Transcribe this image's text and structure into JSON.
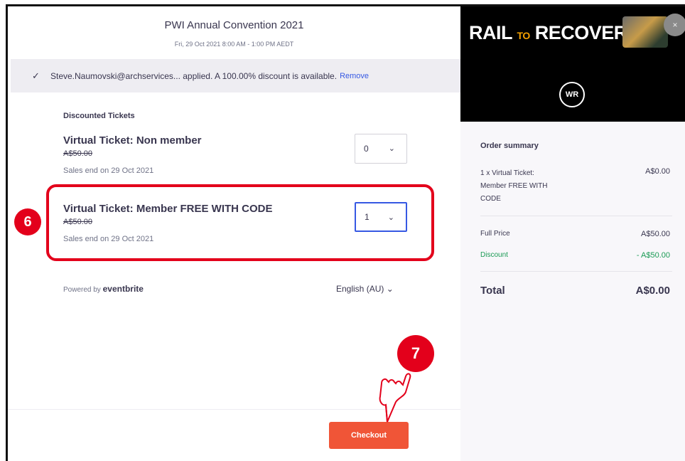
{
  "event": {
    "title": "PWI Annual Convention 2021",
    "datetime": "Fri, 29 Oct 2021 8:00 AM - 1:00 PM AEDT"
  },
  "promo": {
    "message": "Steve.Naumovski@archservices... applied. A 100.00% discount is available.",
    "remove_label": "Remove",
    "icon": "check-icon"
  },
  "tickets": {
    "section_heading": "Discounted Tickets",
    "items": [
      {
        "name": "Virtual Ticket: Non member",
        "price": "A$50.00",
        "sales_end": "Sales end on 29 Oct 2021",
        "quantity": "0"
      },
      {
        "name": "Virtual Ticket: Member FREE WITH CODE",
        "price": "A$50.00",
        "sales_end": "Sales end on 29 Oct 2021",
        "quantity": "1"
      }
    ]
  },
  "footer": {
    "powered_prefix": "Powered by",
    "powered_brand": "eventbrite",
    "language": "English (AU)",
    "checkout_label": "Checkout"
  },
  "annotations": {
    "step6": "6",
    "step7": "7",
    "highlight_color": "#e3001b"
  },
  "hero": {
    "title_rail": "RAIL",
    "title_to": "TO",
    "title_recovery": "RECOVERY",
    "logo_text": "WR",
    "close_label": "×"
  },
  "summary": {
    "title": "Order summary",
    "line_item": "1 x Virtual Ticket: Member FREE WITH CODE",
    "line_amount": "A$0.00",
    "full_price_label": "Full Price",
    "full_price_amount": "A$50.00",
    "discount_label": "Discount",
    "discount_amount": "- A$50.00",
    "total_label": "Total",
    "total_amount": "A$0.00"
  },
  "colors": {
    "accent": "#f05537",
    "link": "#3659e3",
    "discount": "#1b9b55"
  }
}
